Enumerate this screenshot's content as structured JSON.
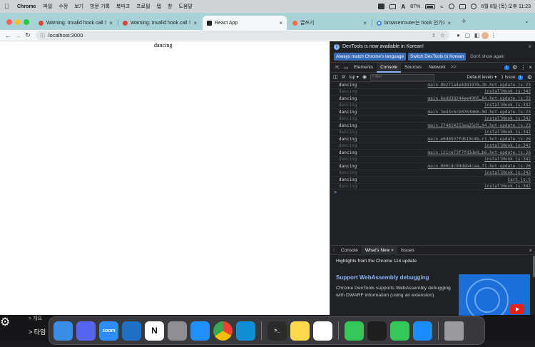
{
  "menubar": {
    "app": "Chrome",
    "items": [
      "파일",
      "수정",
      "보기",
      "방문 기록",
      "북마크",
      "프로필",
      "탭",
      "창",
      "도움말"
    ],
    "battery": "87%",
    "datetime": "6월 8일 (목) 오후 11:23"
  },
  "tabs": [
    {
      "title": "Warning: Invalid hook call 오류",
      "favicon": "#e1453a",
      "active": false
    },
    {
      "title": "Warning: Invalid hook call 오류",
      "favicon": "#e1453a",
      "active": false
    },
    {
      "title": "React App",
      "favicon": "#222222",
      "active": true
    },
    {
      "title": "글쓰기",
      "favicon": "#f46b45",
      "active": false
    },
    {
      "title": "browserrouter는 hook 인가요? -",
      "favicon": "#4285f4",
      "active": false
    }
  ],
  "toolbar": {
    "url": "localhost:3000"
  },
  "page": {
    "text": "dancing"
  },
  "devtools": {
    "notice": {
      "text": "DevTools is now available in Korean!",
      "btn_match": "Always match Chrome's language",
      "btn_switch": "Switch DevTools to Korean",
      "btn_dismiss": "Don't show again"
    },
    "tabs": [
      "Elements",
      "Console",
      "Sources",
      "Network"
    ],
    "selected_tab": "Console",
    "more": ">>",
    "message_count": "1",
    "filter": {
      "context": "top",
      "placeholder": "Filter",
      "levels": "Default levels",
      "issues": "1 Issue:",
      "issues_count": "1"
    },
    "console_rows": [
      {
        "msg": "dancing",
        "src": "main.8b271a4e4dd1970…3b.hot-update.js:23",
        "dim": false
      },
      {
        "msg": "dancing",
        "src": "installHook.js:342",
        "dim": true
      },
      {
        "msg": "dancing",
        "src": "main.6edd38244ee4905…84.hot-update.js:23",
        "dim": false
      },
      {
        "msg": "dancing",
        "src": "installHook.js:342",
        "dim": true
      },
      {
        "msg": "dancing",
        "src": "main.3e43c6cb0763886…9d.hot-update.js:23",
        "dim": false
      },
      {
        "msg": "dancing",
        "src": "installHook.js:342",
        "dim": true
      },
      {
        "msg": "dancing",
        "src": "main.274814253ea25d3…94.hot-update.js:23",
        "dim": false
      },
      {
        "msg": "dancing",
        "src": "installHook.js:342",
        "dim": true
      },
      {
        "msg": "dancing",
        "src": "main.e6d8937fdb19c4b…c1.hot-update.js:26",
        "dim": false
      },
      {
        "msg": "dancing",
        "src": "installHook.js:342",
        "dim": true
      },
      {
        "msg": "dancing",
        "src": "main.121ce73f7fd3de9…b6.hot-update.js:26",
        "dim": false
      },
      {
        "msg": "dancing",
        "src": "installHook.js:342",
        "dim": true
      },
      {
        "msg": "dancing",
        "src": "main.800cdc99deb4caa…71.hot-update.js:26",
        "dim": false
      },
      {
        "msg": "dancing",
        "src": "installHook.js:342",
        "dim": true
      },
      {
        "msg": "dancing",
        "src": "Cart.js:5",
        "dim": false
      },
      {
        "msg": "dancing",
        "src": "installHook.js:342",
        "dim": true
      }
    ],
    "prompt": ">",
    "drawer": {
      "tabs": [
        "Console",
        "What's New",
        "Issues"
      ],
      "selected": "What's New",
      "highlight": "Highlights from the Chrome 114 update",
      "card_title": "Support WebAssembly debugging",
      "card_body": "Chrome DevTools supports WebAssembly debugging with DWARF information (using an extension)."
    }
  },
  "desktop": {
    "left_text_1": "> 개요",
    "left_text_2": "> 타임"
  },
  "dock": [
    {
      "name": "finder",
      "label": "",
      "color": "#3a8ee6"
    },
    {
      "name": "discord",
      "label": "",
      "color": "#5865f2"
    },
    {
      "name": "zoom",
      "label": "zoom",
      "color": "#2d8cff"
    },
    {
      "name": "vscode",
      "label": "",
      "color": "#1f6fc7"
    },
    {
      "name": "notion",
      "label": "N",
      "color": "#ffffff"
    },
    {
      "name": "system-settings",
      "label": "",
      "color": "#8e8e93"
    },
    {
      "name": "app-store",
      "label": "",
      "color": "#1e90ff"
    },
    {
      "name": "chrome",
      "label": "",
      "color": "#ffffff"
    },
    {
      "name": "edge",
      "label": "",
      "color": "#0f8fd6"
    },
    {
      "name": "terminal",
      "label": ">_",
      "color": "#2b2b2b"
    },
    {
      "name": "notes",
      "label": "",
      "color": "#ffd84d"
    },
    {
      "name": "tasks",
      "label": "",
      "color": "#ffffff"
    },
    {
      "name": "messages",
      "label": "",
      "color": "#34c759"
    },
    {
      "name": "figma",
      "label": "",
      "color": "#1e1e1e"
    },
    {
      "name": "facetime",
      "label": "",
      "color": "#34c759"
    },
    {
      "name": "safari",
      "label": "",
      "color": "#1a8cff"
    },
    {
      "name": "trash",
      "label": "",
      "color": "#9a9a9e"
    }
  ]
}
